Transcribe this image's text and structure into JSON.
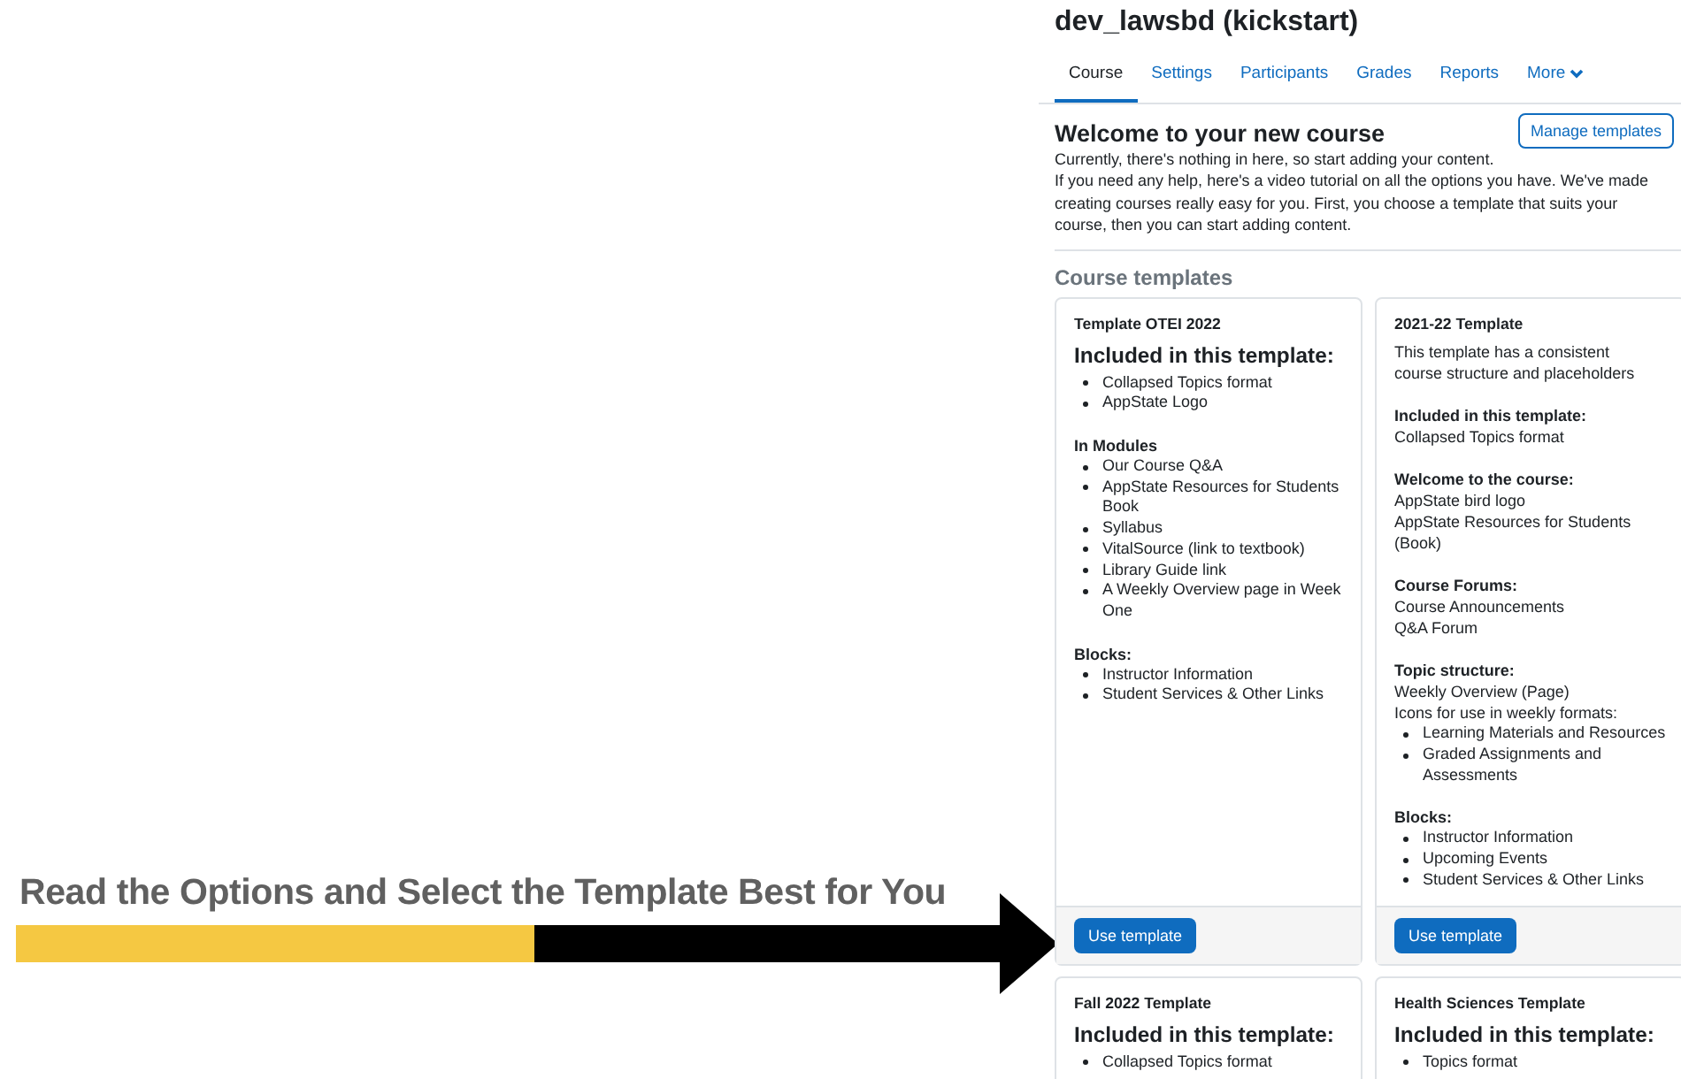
{
  "annotation": {
    "text": "Read the Options and Select the Template Best for You"
  },
  "course": {
    "title": "dev_lawsbd (kickstart)",
    "tabs": [
      {
        "label": "Course",
        "selected": true
      },
      {
        "label": "Settings",
        "selected": false
      },
      {
        "label": "Participants",
        "selected": false
      },
      {
        "label": "Grades",
        "selected": false
      },
      {
        "label": "Reports",
        "selected": false
      },
      {
        "label": "More",
        "selected": false,
        "kind": "menu"
      }
    ],
    "welcome": {
      "heading": "Welcome to your new course",
      "button": "Manage templates",
      "paragraphs": [
        "Currently, there's nothing in here, so start adding your content.",
        "If you need any help, here's a video tutorial on all the options you have. We've made creating courses really easy for you. First, you choose a template that suits your course, then you can start adding content."
      ]
    },
    "templates_heading": "Course templates",
    "templates": [
      {
        "title": "Template OTEI 2022",
        "button": "Use template",
        "blocks": [
          {
            "kind": "heading",
            "text": "Included in this template:"
          },
          {
            "kind": "bullets",
            "items": [
              "Collapsed Topics format",
              "AppState Logo"
            ]
          },
          {
            "kind": "subheading",
            "text": "In Modules"
          },
          {
            "kind": "bullets",
            "items": [
              "Our Course Q&A",
              "AppState Resources for Students Book",
              "Syllabus",
              "VitalSource (link to textbook)",
              "Library Guide link",
              "A Weekly Overview page in Week One"
            ]
          },
          {
            "kind": "subheading",
            "text": "Blocks:"
          },
          {
            "kind": "bullets",
            "items": [
              "Instructor Information",
              "Student Services & Other Links"
            ]
          }
        ]
      },
      {
        "title": "2021-22 Template",
        "button": "Use template",
        "blocks": [
          {
            "kind": "text",
            "text": "This template has a consistent"
          },
          {
            "kind": "line",
            "text": "course structure and placeholders"
          },
          {
            "kind": "subheading",
            "text": "Included in this template:"
          },
          {
            "kind": "line",
            "text": "Collapsed Topics format"
          },
          {
            "kind": "subheading",
            "text": "Welcome to the course:"
          },
          {
            "kind": "line",
            "text": "AppState bird logo"
          },
          {
            "kind": "line",
            "text": "AppState Resources for Students (Book)"
          },
          {
            "kind": "subheading",
            "text": "Course Forums:"
          },
          {
            "kind": "line",
            "text": "Course Announcements"
          },
          {
            "kind": "line",
            "text": "Q&A Forum"
          },
          {
            "kind": "subheading",
            "text": "Topic structure:"
          },
          {
            "kind": "line",
            "text": "Weekly Overview (Page)"
          },
          {
            "kind": "line",
            "text": "Icons for use in weekly formats:"
          },
          {
            "kind": "bullets",
            "items": [
              "Learning Materials and Resources",
              "Graded Assignments and Assessments"
            ]
          },
          {
            "kind": "subheading",
            "text": "Blocks:"
          },
          {
            "kind": "bullets",
            "items": [
              "Instructor Information",
              "Upcoming Events",
              "Student Services & Other Links"
            ]
          }
        ]
      },
      {
        "title": "Fall 2022 Template",
        "blocks": [
          {
            "kind": "heading",
            "text": "Included in this template:"
          },
          {
            "kind": "bullets",
            "items": [
              "Collapsed Topics format"
            ]
          }
        ]
      },
      {
        "title": "Health Sciences Template",
        "blocks": [
          {
            "kind": "heading",
            "text": "Included in this template:"
          },
          {
            "kind": "bullets",
            "items": [
              "Topics format"
            ]
          }
        ]
      }
    ]
  }
}
